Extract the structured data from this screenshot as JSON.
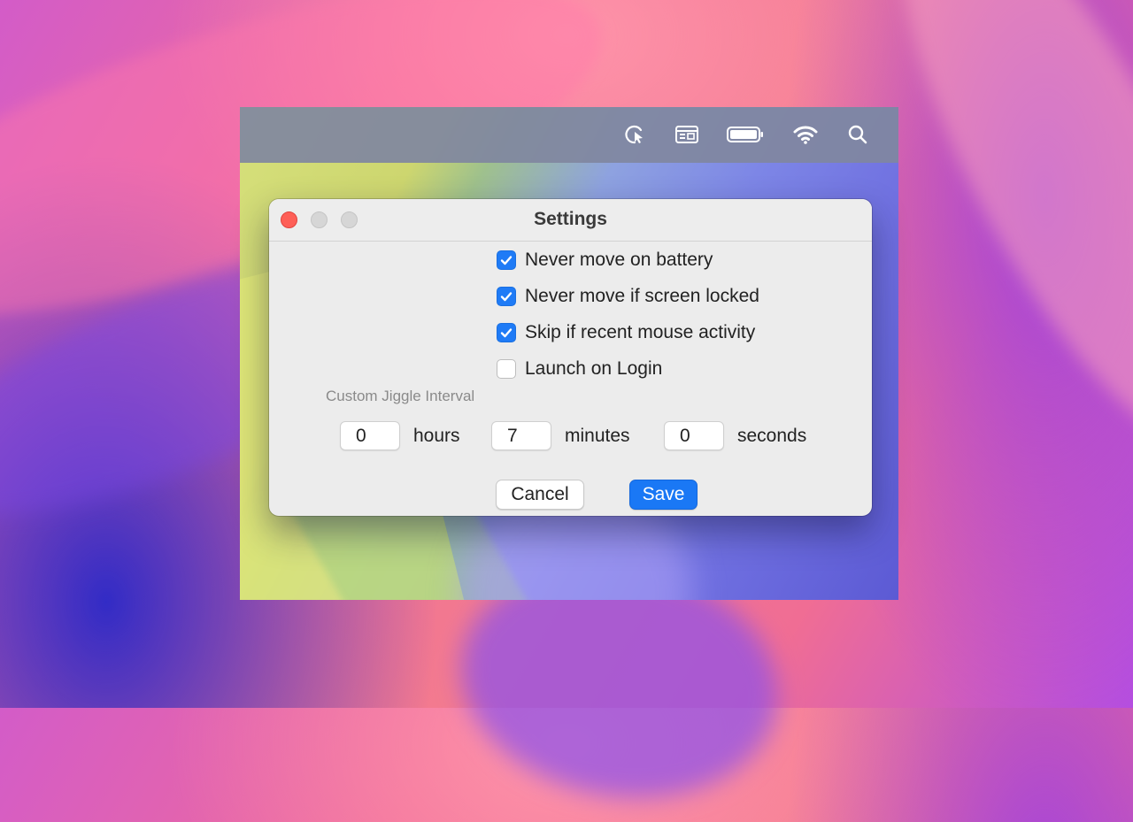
{
  "menubar": {
    "icons": [
      "cursor-click-icon",
      "window-cards-icon",
      "battery-icon",
      "wifi-icon",
      "search-icon"
    ]
  },
  "window": {
    "title": "Settings"
  },
  "options": [
    {
      "label": "Never move on battery",
      "checked": true
    },
    {
      "label": "Never move if screen locked",
      "checked": true
    },
    {
      "label": "Skip if recent mouse activity",
      "checked": true
    },
    {
      "label": "Launch on Login",
      "checked": false
    }
  ],
  "interval": {
    "section_label": "Custom Jiggle Interval",
    "hours_value": "0",
    "hours_label": "hours",
    "minutes_value": "7",
    "minutes_label": "minutes",
    "seconds_value": "0",
    "seconds_label": "seconds"
  },
  "buttons": {
    "cancel_label": "Cancel",
    "save_label": "Save"
  },
  "colors": {
    "accent": "#1a78f5",
    "close_button": "#fe5f57"
  }
}
